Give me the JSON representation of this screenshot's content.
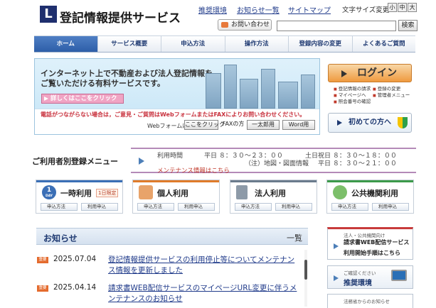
{
  "site": {
    "title": "登記情報提供サービス",
    "logo_mark": "L"
  },
  "header": {
    "links": [
      "推奨環境",
      "お知らせ一覧",
      "サイトマップ"
    ],
    "font_size_label": "文字サイズ変更",
    "font_sizes": [
      "小",
      "中",
      "大"
    ],
    "contact_label": "お問い合わせ",
    "search_placeholder": "",
    "search_button": "検索"
  },
  "nav": {
    "tabs": [
      "ホーム",
      "サービス概要",
      "申込方法",
      "操作方法",
      "登録内容の変更",
      "よくあるご質問"
    ],
    "active_index": 0
  },
  "banner": {
    "headline_1": "インターネット上で不動産および法人登記情報を",
    "headline_2": "ご覧いただける有料サービスです。",
    "detail_label": "詳しくはここをクリック",
    "notice": "電話がつながらない場合は，ご意見・ご質問はWebフォームまたはFAXによりお問い合わせください。",
    "webform_label": "Webフォームは",
    "webform_button": "ここをクリック",
    "fax_label": "FAXの方",
    "ichitaro_button": "一太郎用",
    "word_button": "Word用"
  },
  "login": {
    "label": "ログイン",
    "menu": [
      "登記情報の請求",
      "登録の変更",
      "マイページへ",
      "管理者メニュー",
      "照会番号の確認"
    ]
  },
  "beginner_label": "初めての方へ",
  "menu_heading": "ご利用者別登録メニュー",
  "hours": {
    "label": "利用時間",
    "weekday": "平日 ８：３０～２３：００",
    "weekend": "土日祝日 ８：３０～１８：００",
    "note": "（注）地図・図面情報",
    "note_weekday": "平日 ８：３０～２１：００",
    "maintenance": "メンテナンス情報はこちら"
  },
  "user_cards": [
    {
      "label": "一時利用",
      "badge": "1日限定",
      "icon_text": "1",
      "icon_sub": "DAY",
      "color": "#3b6fb6",
      "buttons": [
        "申込方法",
        "利用申込"
      ]
    },
    {
      "label": "個人利用",
      "badge": "",
      "icon_text": "",
      "icon_sub": "",
      "color": "#e07b2a",
      "buttons": [
        "申込方法",
        "利用申込"
      ]
    },
    {
      "label": "法人利用",
      "badge": "",
      "icon_text": "",
      "icon_sub": "",
      "color": "#6b7b8c",
      "buttons": [
        "申込方法",
        "利用申込"
      ]
    },
    {
      "label": "公共機関利用",
      "badge": "",
      "icon_text": "",
      "icon_sub": "",
      "color": "#3c9a4a",
      "buttons": [
        "申込方法",
        "利用申込"
      ]
    }
  ],
  "news": {
    "title": "お知らせ",
    "all_label": "一覧",
    "tag_label": "重要",
    "items": [
      {
        "date": "2025.07.04",
        "text": "登記情報提供サービスの利用停止等についてメンテナンス情報を更新しました"
      },
      {
        "date": "2025.04.14",
        "text": "請求書WEB配信サービスのマイページURL変更に伴うメンテナンスのお知らせ"
      }
    ]
  },
  "promos": {
    "invoice_small": "法人・公共機関向け",
    "invoice_title": "請求書WEB配信サービス",
    "invoice_sub": "利用開始手順はこちら",
    "env_small": "ご確認ください",
    "env_title": "推奨環境",
    "bureau_small": "法務省からのお知らせ"
  }
}
